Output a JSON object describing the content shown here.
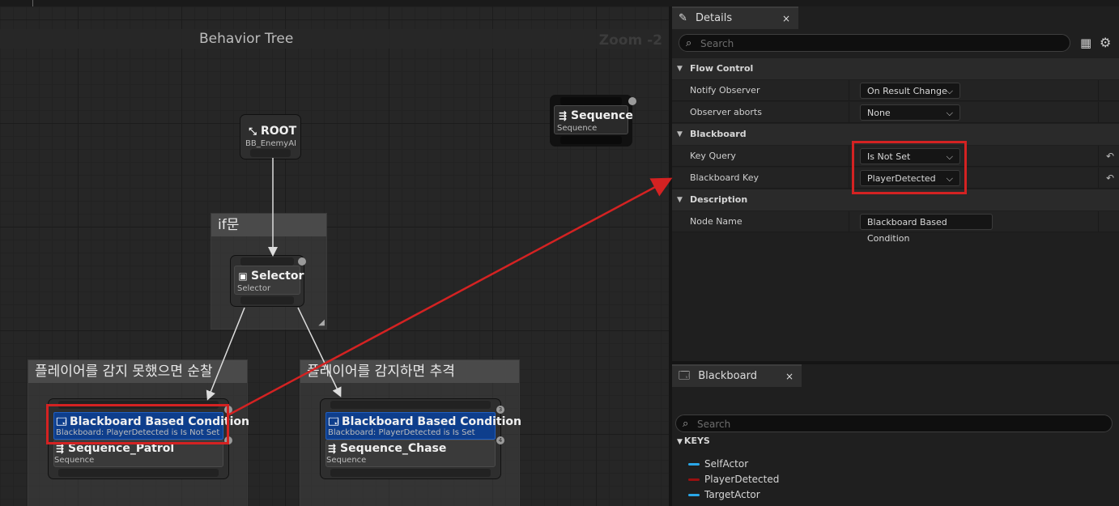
{
  "graph": {
    "title": "Behavior Tree",
    "zoom": "Zoom -2",
    "comments": {
      "if": "if문",
      "patrol": "플레이어를 감지 못했으면 순찰",
      "chase": "플레이어를 감지하면 추격"
    },
    "nodes": {
      "root": {
        "title": "ROOT",
        "sub": "BB_EnemyAI"
      },
      "selector": {
        "title": "Selector",
        "sub": "Selector"
      },
      "sequence": {
        "title": "Sequence",
        "sub": "Sequence"
      },
      "patrol_deco": {
        "title": "Blackboard Based Condition",
        "sub": "Blackboard: PlayerDetected is Is Not Set"
      },
      "patrol_seq": {
        "title": "Sequence_Patrol",
        "sub": "Sequence"
      },
      "chase_deco": {
        "title": "Blackboard Based Condition",
        "sub": "Blackboard: PlayerDetected is Is Set"
      },
      "chase_seq": {
        "title": "Sequence_Chase",
        "sub": "Sequence"
      },
      "chase_badges": [
        "3",
        "4"
      ]
    }
  },
  "details": {
    "tab": "Details",
    "close": "×",
    "search_placeholder": "Search",
    "categories": {
      "flow": "Flow Control",
      "blackboard": "Blackboard",
      "description": "Description"
    },
    "rows": {
      "notify_label": "Notify Observer",
      "notify_value": "On Result Change",
      "aborts_label": "Observer aborts",
      "aborts_value": "None",
      "keyquery_label": "Key Query",
      "keyquery_value": "Is Not Set",
      "bbkey_label": "Blackboard Key",
      "bbkey_value": "PlayerDetected",
      "nodename_label": "Node Name",
      "nodename_value": "Blackboard Based Condition"
    }
  },
  "blackboard": {
    "tab": "Blackboard",
    "close": "×",
    "search_placeholder": "Search",
    "keys_header": "KEYS",
    "keys": [
      {
        "name": "SelfActor",
        "color": "#2aa7e8"
      },
      {
        "name": "PlayerDetected",
        "color": "#9a1010"
      },
      {
        "name": "TargetActor",
        "color": "#2aa7e8"
      }
    ]
  },
  "colors": {
    "highlight": "#d42222",
    "decorator": "#0e3e8c"
  }
}
